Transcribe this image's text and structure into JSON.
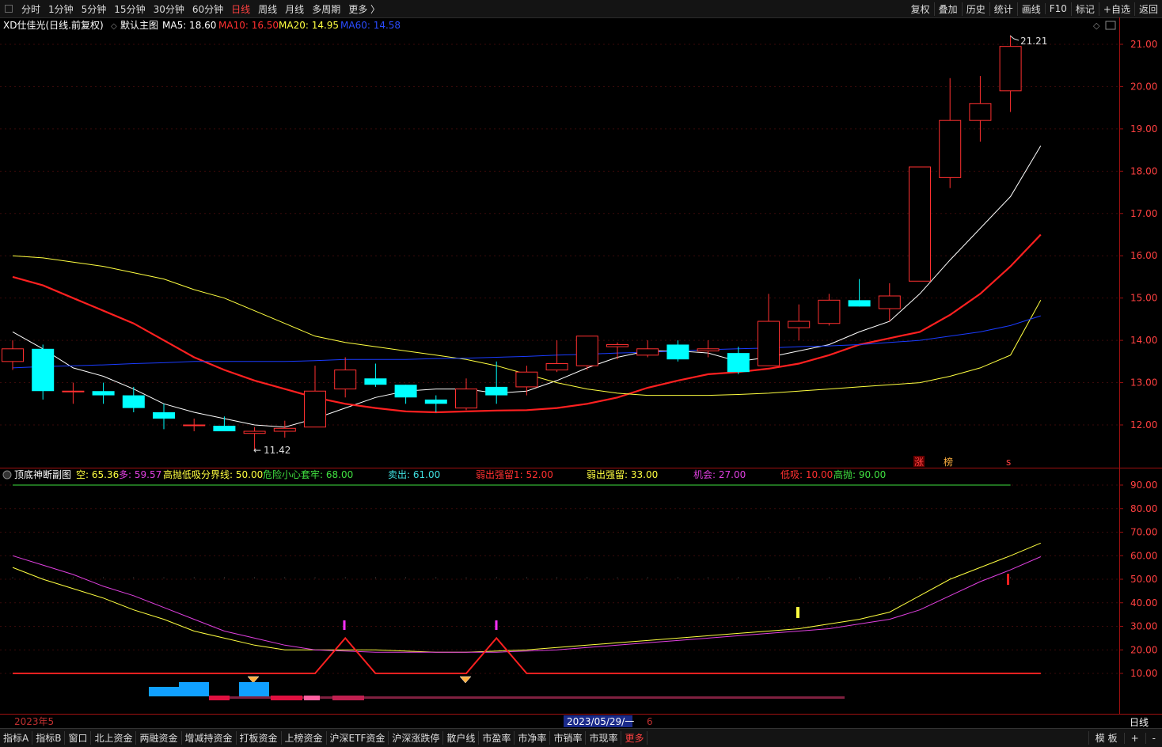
{
  "toolbar": {
    "periods": [
      "分时",
      "1分钟",
      "5分钟",
      "15分钟",
      "30分钟",
      "60分钟",
      "日线",
      "周线",
      "月线",
      "多周期",
      "更多 〉"
    ],
    "active_period": "日线",
    "tools": [
      "复权",
      "叠加",
      "历史",
      "统计",
      "画线",
      "F10",
      "标记",
      "+自选",
      "返回"
    ]
  },
  "main_legend": {
    "stock": "XD仕佳光(日线.前复权)",
    "template": "默认主图",
    "ma5": "MA5: 18.60",
    "ma10": "MA10: 16.50",
    "ma20": "MA20: 14.95",
    "ma60": "MA60: 14.58"
  },
  "sub_legend": {
    "title": "顶底神断副图",
    "items": [
      {
        "text": "空: 65.36",
        "color": "#ffff40"
      },
      {
        "text": "多: 59.57",
        "color": "#e040e0"
      },
      {
        "text": "高抛低吸分界线: 50.00",
        "color": "#ffff40"
      },
      {
        "text": "危险小心套牢: 68.00",
        "color": "#40e040"
      },
      {
        "text": "卖出: 61.00",
        "color": "#40e0e0"
      },
      {
        "text": "弱出强留1: 52.00",
        "color": "#ff3030"
      },
      {
        "text": "弱出强留: 33.00",
        "color": "#ffff40"
      },
      {
        "text": "机会: 27.00",
        "color": "#e040e0"
      },
      {
        "text": "低吸: 10.00",
        "color": "#ff3030"
      },
      {
        "text": "高抛: 90.00",
        "color": "#40e040"
      }
    ]
  },
  "annotations": {
    "high": "21.21",
    "low": "11.42",
    "marker_zhang": "涨",
    "marker_bang": "榜",
    "marker_s": "s"
  },
  "axis_bottom": {
    "date_start": "2023年5",
    "cursor_date": "2023/05/29/一",
    "tick6": "6",
    "period_label": "日线"
  },
  "bottom_tabs": [
    "指标A",
    "指标B",
    "窗口",
    "北上资金",
    "两融资金",
    "增减持资金",
    "打板资金",
    "上榜资金",
    "沪深ETF资金",
    "沪深涨跌停",
    "散户线",
    "市盈率",
    "市净率",
    "市销率",
    "市现率",
    "更多"
  ],
  "bottom_active": "更多",
  "bottom_right": [
    "模 板",
    "+",
    "-"
  ],
  "colors": {
    "up": "#ff3030",
    "down": "#00ffff",
    "ma5": "#ffffff",
    "ma10": "#ff2020",
    "ma20": "#ffff40",
    "ma60": "#1a3cff"
  },
  "chart_data": [
    {
      "type": "candlestick",
      "title": "XD仕佳光(日线.前复权)",
      "y_ticks": [
        "21.00",
        "20.00",
        "19.00",
        "18.00",
        "17.00",
        "16.00",
        "15.00",
        "14.00",
        "13.00",
        "12.00"
      ],
      "ylim": [
        11.0,
        21.5
      ],
      "candles": [
        {
          "o": 13.5,
          "h": 14.0,
          "l": 13.3,
          "c": 13.8
        },
        {
          "o": 13.8,
          "h": 13.9,
          "l": 12.6,
          "c": 12.8
        },
        {
          "o": 12.8,
          "h": 13.0,
          "l": 12.5,
          "c": 12.8
        },
        {
          "o": 12.8,
          "h": 13.0,
          "l": 12.5,
          "c": 12.7
        },
        {
          "o": 12.7,
          "h": 12.9,
          "l": 12.3,
          "c": 12.4
        },
        {
          "o": 12.3,
          "h": 12.5,
          "l": 11.9,
          "c": 12.15
        },
        {
          "o": 12.0,
          "h": 12.15,
          "l": 11.85,
          "c": 12.0
        },
        {
          "o": 11.98,
          "h": 12.2,
          "l": 11.85,
          "c": 11.85
        },
        {
          "o": 11.8,
          "h": 11.95,
          "l": 11.42,
          "c": 11.85
        },
        {
          "o": 11.85,
          "h": 12.1,
          "l": 11.7,
          "c": 11.92
        },
        {
          "o": 11.95,
          "h": 13.4,
          "l": 11.95,
          "c": 12.8
        },
        {
          "o": 12.85,
          "h": 13.6,
          "l": 12.65,
          "c": 13.3
        },
        {
          "o": 13.1,
          "h": 13.45,
          "l": 12.9,
          "c": 12.95
        },
        {
          "o": 12.95,
          "h": 12.95,
          "l": 12.5,
          "c": 12.65
        },
        {
          "o": 12.6,
          "h": 12.7,
          "l": 12.3,
          "c": 12.5
        },
        {
          "o": 12.4,
          "h": 13.1,
          "l": 12.35,
          "c": 12.85
        },
        {
          "o": 12.9,
          "h": 13.5,
          "l": 12.5,
          "c": 12.7
        },
        {
          "o": 12.9,
          "h": 13.4,
          "l": 12.7,
          "c": 13.25
        },
        {
          "o": 13.3,
          "h": 14.0,
          "l": 13.25,
          "c": 13.45
        },
        {
          "o": 13.4,
          "h": 14.1,
          "l": 13.3,
          "c": 14.1
        },
        {
          "o": 13.85,
          "h": 13.95,
          "l": 13.55,
          "c": 13.9
        },
        {
          "o": 13.65,
          "h": 14.0,
          "l": 13.6,
          "c": 13.8
        },
        {
          "o": 13.9,
          "h": 14.0,
          "l": 13.5,
          "c": 13.55
        },
        {
          "o": 13.75,
          "h": 14.0,
          "l": 13.6,
          "c": 13.8
        },
        {
          "o": 13.7,
          "h": 13.85,
          "l": 13.2,
          "c": 13.25
        },
        {
          "o": 13.4,
          "h": 15.1,
          "l": 13.4,
          "c": 14.45
        },
        {
          "o": 14.3,
          "h": 14.85,
          "l": 14.0,
          "c": 14.45
        },
        {
          "o": 14.4,
          "h": 15.1,
          "l": 14.35,
          "c": 14.95
        },
        {
          "o": 14.95,
          "h": 15.45,
          "l": 14.8,
          "c": 14.8
        },
        {
          "o": 14.75,
          "h": 15.35,
          "l": 14.45,
          "c": 15.05
        },
        {
          "o": 15.4,
          "h": 18.1,
          "l": 15.4,
          "c": 18.1
        },
        {
          "o": 17.85,
          "h": 20.2,
          "l": 17.6,
          "c": 19.2
        },
        {
          "o": 19.2,
          "h": 20.25,
          "l": 18.7,
          "c": 19.6
        },
        {
          "o": 19.9,
          "h": 21.21,
          "l": 19.4,
          "c": 20.95
        }
      ],
      "series": [
        {
          "name": "MA5",
          "values": [
            14.2,
            13.8,
            13.35,
            13.15,
            12.85,
            12.5,
            12.3,
            12.15,
            12.0,
            11.95,
            12.15,
            12.4,
            12.65,
            12.8,
            12.85,
            12.85,
            12.75,
            12.8,
            13.05,
            13.35,
            13.6,
            13.75,
            13.75,
            13.7,
            13.5,
            13.6,
            13.75,
            13.9,
            14.2,
            14.45,
            15.1,
            15.9,
            16.65,
            17.4,
            18.6
          ]
        },
        {
          "name": "MA10",
          "values": [
            15.5,
            15.3,
            15.0,
            14.7,
            14.4,
            14.0,
            13.6,
            13.3,
            13.05,
            12.85,
            12.65,
            12.5,
            12.4,
            12.32,
            12.3,
            12.32,
            12.34,
            12.35,
            12.4,
            12.5,
            12.65,
            12.88,
            13.05,
            13.2,
            13.25,
            13.33,
            13.45,
            13.65,
            13.9,
            14.05,
            14.2,
            14.6,
            15.1,
            15.75,
            16.5
          ]
        },
        {
          "name": "MA20",
          "values": [
            16.0,
            15.95,
            15.85,
            15.75,
            15.6,
            15.45,
            15.2,
            15.0,
            14.7,
            14.4,
            14.1,
            13.95,
            13.85,
            13.75,
            13.65,
            13.55,
            13.4,
            13.2,
            13.0,
            12.85,
            12.75,
            12.7,
            12.7,
            12.7,
            12.72,
            12.75,
            12.8,
            12.85,
            12.9,
            12.95,
            13.0,
            13.15,
            13.35,
            13.65,
            14.95
          ]
        },
        {
          "name": "MA60",
          "values": [
            13.35,
            13.38,
            13.4,
            13.42,
            13.45,
            13.47,
            13.5,
            13.5,
            13.5,
            13.5,
            13.52,
            13.55,
            13.55,
            13.55,
            13.57,
            13.58,
            13.6,
            13.62,
            13.65,
            13.67,
            13.7,
            13.72,
            13.75,
            13.78,
            13.8,
            13.82,
            13.85,
            13.87,
            13.9,
            13.95,
            14.0,
            14.1,
            14.2,
            14.35,
            14.58
          ]
        }
      ]
    },
    {
      "type": "line",
      "title": "顶底神断副图",
      "y_ticks": [
        "90.00",
        "80.00",
        "70.00",
        "60.00",
        "50.00",
        "40.00",
        "30.00",
        "20.00",
        "10.00"
      ],
      "ylim": [
        0,
        96
      ],
      "series": [
        {
          "name": "空",
          "values": [
            55.0,
            50.0,
            46.0,
            42.0,
            37.0,
            33.0,
            28.0,
            25.0,
            22.0,
            20.0,
            20.0,
            20.0,
            20.0,
            19.5,
            19.0,
            19.0,
            19.5,
            20.0,
            21.0,
            22.0,
            23.0,
            24.0,
            25.0,
            26.0,
            27.0,
            28.0,
            29.0,
            31.0,
            33.0,
            36.0,
            43.0,
            50.0,
            55.0,
            60.0,
            65.36
          ]
        },
        {
          "name": "多",
          "values": [
            60.0,
            56.0,
            52.0,
            47.0,
            43.0,
            38.0,
            33.0,
            28.0,
            25.0,
            22.0,
            20.0,
            19.5,
            19.0,
            19.0,
            19.0,
            19.0,
            19.0,
            19.5,
            20.0,
            21.0,
            22.0,
            23.0,
            24.0,
            25.0,
            26.0,
            27.0,
            28.0,
            29.0,
            31.0,
            33.0,
            37.0,
            43.0,
            49.0,
            54.0,
            59.57
          ]
        },
        {
          "name": "低吸",
          "values": [
            10,
            10,
            10,
            10,
            10,
            10,
            10,
            10,
            10,
            10,
            10,
            25,
            10,
            10,
            10,
            10,
            25,
            10,
            10,
            10,
            10,
            10,
            10,
            10,
            10,
            10,
            10,
            10,
            10,
            10,
            10,
            10,
            10,
            10,
            10
          ]
        },
        {
          "name": "高抛",
          "values": [
            90,
            90,
            90,
            90,
            90,
            90,
            90,
            90,
            90,
            90,
            90,
            90,
            90,
            90,
            90,
            90,
            90,
            90,
            90,
            90,
            90,
            90,
            90,
            90,
            90,
            90,
            90,
            90,
            90,
            90,
            90,
            90,
            90,
            90,
            90
          ]
        }
      ]
    }
  ]
}
